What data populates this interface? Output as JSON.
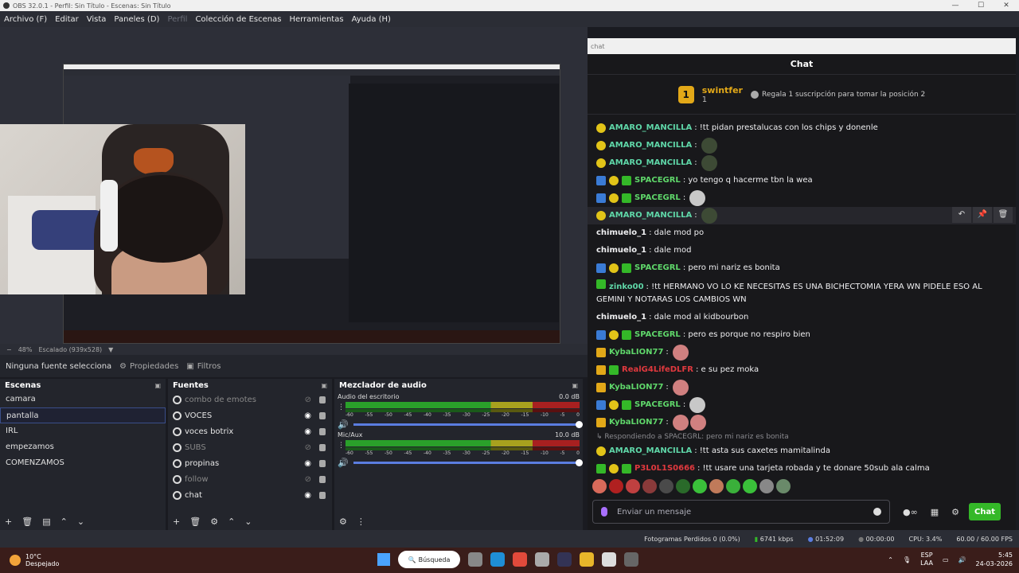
{
  "window": {
    "title": "OBS 32.0.1 - Perfil: Sin Título - Escenas: Sin Título",
    "minimize": "—",
    "maximize": "☐",
    "close": "✕"
  },
  "menu": [
    {
      "label": "Archivo (F)",
      "dim": false
    },
    {
      "label": "Editar",
      "dim": false
    },
    {
      "label": "Vista",
      "dim": false
    },
    {
      "label": "Paneles (D)",
      "dim": false
    },
    {
      "label": "Perfil",
      "dim": true
    },
    {
      "label": "Colección de Escenas",
      "dim": false
    },
    {
      "label": "Herramientas",
      "dim": false
    },
    {
      "label": "Ayuda (H)",
      "dim": false
    }
  ],
  "preview_controls": {
    "zoom": "48%",
    "scaling": "Escalado (939x528)"
  },
  "properties_bar": {
    "no_source": "Ninguna fuente seleccionada",
    "properties": "Propiedades",
    "filters": "Filtros"
  },
  "scenes": {
    "title": "Escenas",
    "items": [
      "camara",
      "pantalla",
      "IRL",
      "empezamos",
      "COMENZAMOS"
    ],
    "selected": "pantalla"
  },
  "sources": {
    "title": "Fuentes",
    "items": [
      {
        "name": "combo de emotes",
        "visible": false
      },
      {
        "name": "VOCES",
        "visible": true
      },
      {
        "name": "voces botrix",
        "visible": true
      },
      {
        "name": "SUBS",
        "visible": false
      },
      {
        "name": "propinas",
        "visible": true
      },
      {
        "name": "follow",
        "visible": false
      },
      {
        "name": "chat",
        "visible": true
      }
    ]
  },
  "mixer": {
    "title": "Mezclador de audio",
    "channels": [
      {
        "name": "Audio del escritorio",
        "db": "0.0 dB"
      },
      {
        "name": "Mic/Aux",
        "db": "10.0 dB"
      }
    ],
    "ticks": [
      "-60",
      "-55",
      "-50",
      "-45",
      "-40",
      "-35",
      "-30",
      "-25",
      "-20",
      "-15",
      "-10",
      "-5",
      "0"
    ]
  },
  "chat": {
    "window_title": "chat",
    "header": "Chat",
    "pinned": {
      "user": "swintfer",
      "rank": "1",
      "count": "1",
      "gift_text": "Regala 1 suscripción para tomar la posición 2"
    },
    "messages": [
      {
        "user": "AMARO_MANCILLA",
        "color": "#5fd7a8",
        "badges": [
          "bulb"
        ],
        "text": "!tt pidan prestalucas con los chips y donenle",
        "emotes": []
      },
      {
        "user": "AMARO_MANCILLA",
        "color": "#5fd7a8",
        "badges": [
          "bulb"
        ],
        "text": "",
        "emotes": [
          "alien"
        ]
      },
      {
        "user": "AMARO_MANCILLA",
        "color": "#5fd7a8",
        "badges": [
          "bulb"
        ],
        "text": "",
        "emotes": [
          "alien"
        ]
      },
      {
        "user": "SPACEGRL",
        "color": "#5fd76a",
        "badges": [
          "cross",
          "bulb",
          "gift"
        ],
        "text": "yo tengo q hacerme tbn la wea",
        "emotes": []
      },
      {
        "user": "SPACEGRL",
        "color": "#5fd76a",
        "badges": [
          "cross",
          "bulb",
          "gift"
        ],
        "text": "",
        "emotes": [
          "cat"
        ]
      },
      {
        "user": "AMARO_MANCILLA",
        "color": "#5fd7a8",
        "badges": [
          "bulb"
        ],
        "text": "",
        "emotes": [
          "alien"
        ],
        "highlight": true
      },
      {
        "user": "chimuelo_1",
        "color": "#efeff1",
        "badges": [],
        "text": "dale mod po",
        "emotes": []
      },
      {
        "user": "chimuelo_1",
        "color": "#efeff1",
        "badges": [],
        "text": "dale mod",
        "emotes": []
      },
      {
        "user": "SPACEGRL",
        "color": "#5fd76a",
        "badges": [
          "cross",
          "bulb",
          "gift"
        ],
        "text": "pero mi nariz es bonita",
        "emotes": []
      },
      {
        "user": "zinko00",
        "color": "#5fd7a8",
        "badges": [
          "gift2"
        ],
        "text": "!tt HERMANO VO LO KE NECESITAS ES UNA BICHECTOMIA YERA WN PIDELE ESO AL GEMINI Y NOTARAS LOS CAMBIOS WN",
        "emotes": [],
        "multi": true
      },
      {
        "user": "chimuelo_1",
        "color": "#efeff1",
        "badges": [],
        "text": "dale mod al kidbourbon",
        "emotes": []
      },
      {
        "user": "SPACEGRL",
        "color": "#5fd76a",
        "badges": [
          "cross",
          "bulb",
          "gift"
        ],
        "text": "pero es porque no respiro bien",
        "emotes": []
      },
      {
        "user": "KybaLION77",
        "color": "#5fd76a",
        "badges": [
          "crown"
        ],
        "text": "",
        "emotes": [
          "face"
        ]
      },
      {
        "user": "RealG4LifeDLFR",
        "color": "#e0393e",
        "badges": [
          "crown",
          "gift"
        ],
        "text": "e su pez moka",
        "emotes": []
      },
      {
        "user": "KybaLION77",
        "color": "#5fd76a",
        "badges": [
          "crown"
        ],
        "text": "",
        "emotes": [
          "face"
        ]
      },
      {
        "user": "SPACEGRL",
        "color": "#5fd76a",
        "badges": [
          "cross",
          "bulb",
          "gift"
        ],
        "text": "",
        "emotes": [
          "cat"
        ]
      },
      {
        "user": "KybaLION77",
        "color": "#5fd76a",
        "badges": [
          "crown"
        ],
        "text": "",
        "emotes": [
          "face",
          "face"
        ]
      }
    ],
    "reply_note": "Respondiendo a SPACEGRL: pero mi nariz es bonita",
    "after_reply": [
      {
        "user": "AMARO_MANCILLA",
        "color": "#5fd7a8",
        "badges": [
          "bulb"
        ],
        "text": "!tt asta sus caxetes mamitalinda",
        "emotes": []
      },
      {
        "user": "P3L0L1S0666",
        "color": "#e0393e",
        "badges": [
          "gift2",
          "bulb",
          "gift"
        ],
        "text": "!tt usare una tarjeta robada y te donare 50sub ala calma",
        "emotes": []
      }
    ],
    "input_placeholder": "Enviar un mensaje",
    "send": "Chat"
  },
  "status": {
    "dropped": "Fotogramas Perdidos 0 (0.0%)",
    "bitrate": "6741 kbps",
    "stream_time": "01:52:09",
    "rec_time": "00:00:00",
    "cpu": "CPU: 3.4%",
    "fps": "60.00 / 60.00 FPS"
  },
  "taskbar": {
    "temp": "10°C",
    "weather": "Despejado",
    "search": "Búsqueda",
    "lang1": "ESP",
    "lang2": "LAA",
    "time": "5:45",
    "date": "24-03-2026"
  }
}
